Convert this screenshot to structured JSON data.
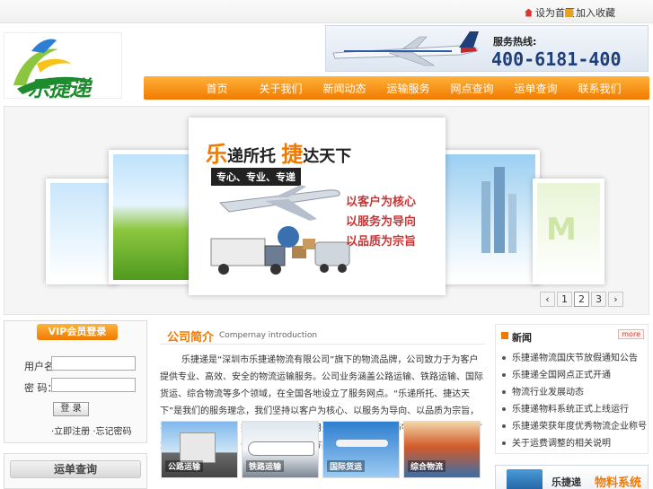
{
  "top_links": {
    "home": "设为首页",
    "favorite": "加入收藏"
  },
  "logo": {
    "text": "乐捷递"
  },
  "hotline": {
    "label": "服务热线:",
    "number": "400-6181-400"
  },
  "nav": {
    "items": [
      "首页",
      "关于我们",
      "新闻动态",
      "运输服务",
      "网点查询",
      "运单查询",
      "联系我们"
    ]
  },
  "slider": {
    "slogan_a": "乐",
    "slogan_b": "递所托",
    "slogan_c": "捷",
    "slogan_d": "达天下",
    "subtitle": "专心、专业、专递",
    "lines": [
      "以客户为核心",
      "以服务为导向",
      "以品质为宗旨"
    ],
    "pages": [
      "1",
      "2",
      "3"
    ],
    "active_page": 2,
    "prev": "‹",
    "next": "›"
  },
  "vip": {
    "title": "VIP会员登录",
    "username_label": "用户名：",
    "password_label": "密  码：",
    "login_button": "登 录",
    "links": [
      "·立即注册",
      "·忘记密码"
    ]
  },
  "waybill": {
    "title": "运单查询"
  },
  "intro": {
    "title": "公司简介",
    "subtitle": "Compernay introduction",
    "text": "乐捷递是“深圳市乐捷递物流有限公司”旗下的物流品牌，公司致力于为客户提供专业、高效、安全的物流运输服务。公司业务涵盖公路运输、铁路运输、国际货运、综合物流等多个领域，在全国各地设立了服务网点。“乐递所托、捷达天下”是我们的服务理念，我们坚持以客户为核心、以服务为导向、以品质为宗旨，不断提升服务水平，完善服务网络，运用先进的IT信息技术与物流管理系统，为广大客户提供全方位、一站式的物流解决方案。",
    "thumbs": [
      "公路运输",
      "铁路运输",
      "国际货运",
      "综合物流"
    ]
  },
  "news": {
    "title": "新闻",
    "more": "more",
    "items": [
      "乐捷递物流国庆节放假通知公告",
      "乐捷递全国网点正式开通",
      "物流行业发展动态",
      "乐捷递物料系统正式上线运行",
      "乐捷递荣获年度优秀物流企业称号",
      "关于运费调整的相关说明"
    ]
  },
  "material": {
    "brand": "乐捷递",
    "name": "物料系统"
  },
  "colors": {
    "accent": "#f07a00",
    "nav_top": "#ffb23a",
    "brand_green": "#1d8b2e",
    "hotline_blue": "#1e3f7a"
  }
}
